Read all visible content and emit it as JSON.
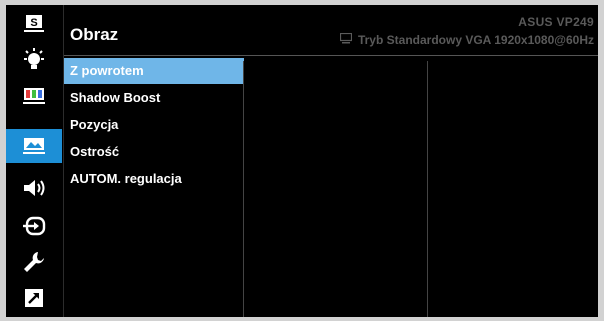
{
  "header": {
    "title": "Obraz",
    "model": "ASUS  VP249",
    "status": "Tryb Standardowy  VGA  1920x1080@60Hz"
  },
  "sidebar": {
    "icons": [
      {
        "name": "splendid-icon",
        "active": false
      },
      {
        "name": "blue-light-filter-icon",
        "active": false
      },
      {
        "name": "color-icon",
        "active": false
      },
      {
        "name": "image-icon",
        "active": true
      },
      {
        "name": "sound-icon",
        "active": false
      },
      {
        "name": "input-select-icon",
        "active": false
      },
      {
        "name": "system-setup-icon",
        "active": false
      },
      {
        "name": "shortcut-icon",
        "active": false
      }
    ]
  },
  "menu": {
    "items": [
      {
        "label": "Z powrotem",
        "selected": true
      },
      {
        "label": "Shadow Boost",
        "selected": false
      },
      {
        "label": "Pozycja",
        "selected": false
      },
      {
        "label": "Ostrość",
        "selected": false
      },
      {
        "label": "AUTOM. regulacja",
        "selected": false
      }
    ]
  },
  "colors": {
    "background": "#000000",
    "active_icon_bg": "#1d8fd6",
    "selected_item_bg": "#6fb6e8",
    "header_text": "#5a5a5a"
  }
}
